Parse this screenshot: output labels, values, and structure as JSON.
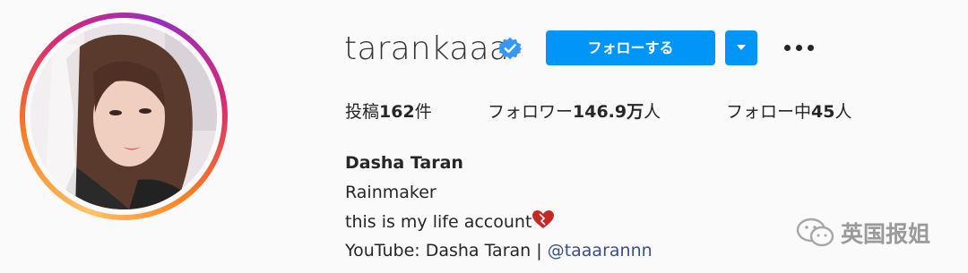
{
  "profile": {
    "username": "tarankaaa",
    "follow_label": "フォローする",
    "stats": {
      "posts_prefix": "投稿",
      "posts_count": "162",
      "posts_suffix": "件",
      "followers_prefix": "フォロワー",
      "followers_count": "146.9万",
      "followers_suffix": "人",
      "following_prefix": "フォロー中",
      "following_count": "45",
      "following_suffix": "人"
    },
    "bio": {
      "name": "Dasha Taran",
      "line1": "Rainmaker",
      "line2": "this is my life account",
      "line3_prefix": "YouTube: Dasha Taran | ",
      "line3_mention": "@taaarannn"
    }
  },
  "watermark": {
    "text": "英国报姐"
  },
  "colors": {
    "accent": "#0095f6",
    "mention": "#385185",
    "verified": "#3897f0",
    "text": "#262626"
  }
}
